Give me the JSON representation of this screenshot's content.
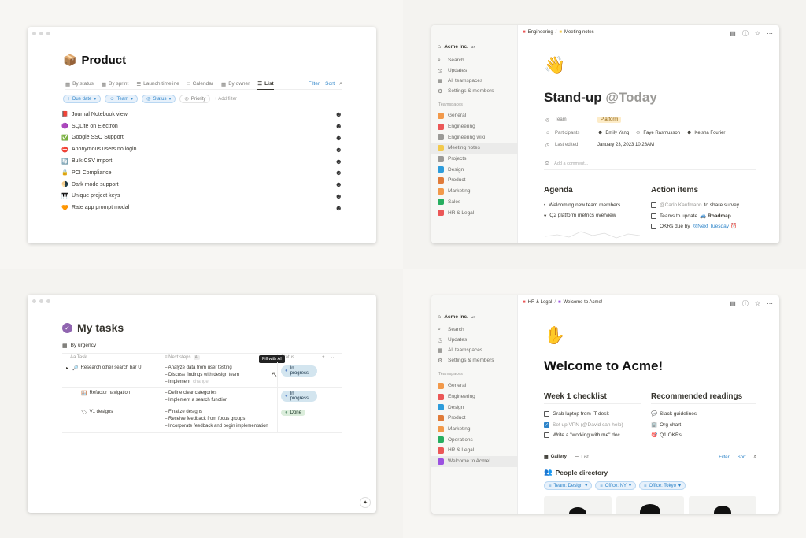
{
  "w1": {
    "title": "Product",
    "title_icon": "cube-icon",
    "tabs": [
      "By status",
      "By sprint",
      "Launch timeline",
      "Calendar",
      "By owner",
      "List"
    ],
    "filter": "Filter",
    "sort": "Sort",
    "filters": [
      "Due date",
      "Team",
      "Status",
      "Priority"
    ],
    "add_filter": "+ Add filter",
    "rows": [
      {
        "icon": "📕",
        "label": "Journal Notebook view"
      },
      {
        "icon": "🟣",
        "label": "SQLite on Electron"
      },
      {
        "icon": "✅",
        "label": "Google SSO Support"
      },
      {
        "icon": "⛔",
        "label": "Anonymous users no login"
      },
      {
        "icon": "🔄",
        "label": "Bulk CSV import"
      },
      {
        "icon": "🔒",
        "label": "PCI Compliance"
      },
      {
        "icon": "🌗",
        "label": "Dark mode support"
      },
      {
        "icon": "🎹",
        "label": "Unique project keys"
      },
      {
        "icon": "🧡",
        "label": "Rate app prompt modal"
      }
    ]
  },
  "w2": {
    "breadcrumb": [
      "Engineering",
      "Meeting notes"
    ],
    "workspace": "Acme Inc.",
    "nav": [
      "Search",
      "Updates",
      "All teamspaces",
      "Settings & members"
    ],
    "teamspaces_label": "Teamspaces",
    "teams": [
      {
        "label": "General",
        "color": "#f2994a"
      },
      {
        "label": "Engineering",
        "color": "#eb5757"
      },
      {
        "label": "Engineering wiki",
        "color": "#9b9a97"
      },
      {
        "label": "Meeting notes",
        "color": "#f2c94c"
      },
      {
        "label": "Projects",
        "color": "#9b9a97"
      },
      {
        "label": "Design",
        "color": "#2d9cdb"
      },
      {
        "label": "Product",
        "color": "#e07b39"
      },
      {
        "label": "Marketing",
        "color": "#f2994a"
      },
      {
        "label": "Sales",
        "color": "#27ae60"
      },
      {
        "label": "HR & Legal",
        "color": "#eb5757"
      }
    ],
    "title": "Stand-up",
    "title_mention": "@Today",
    "props": {
      "team_label": "Team",
      "team_value": "Platform",
      "participants_label": "Participants",
      "participants": [
        "Emily Yang",
        "Faye Rasmusson",
        "Keisha Fourier"
      ],
      "edited_label": "Last edited",
      "edited_value": "January 23, 2023 10:28AM"
    },
    "comment_placeholder": "Add a comment...",
    "agenda_title": "Agenda",
    "agenda": [
      "Welcoming new team members",
      "Q2 platform metrics overview"
    ],
    "actions_title": "Action items",
    "actions": [
      {
        "pre": "@Carlo Kaufmann",
        "text": "to share survey"
      },
      {
        "pre": "Teams to update",
        "link": "Roadmap"
      },
      {
        "pre": "OKRs due by",
        "link": "@Next Tuesday"
      }
    ]
  },
  "w3": {
    "title": "My tasks",
    "view": "By urgency",
    "cols": [
      "Task",
      "Next steps",
      "Status"
    ],
    "tooltip": "Fill with AI",
    "rows": [
      {
        "icon": "🔎",
        "task": "Research other search bar UI",
        "steps": [
          "– Analyze data from user testing",
          "– Discuss findings with design team",
          "– Implement"
        ],
        "steps_ghost": "change",
        "status": "In progress"
      },
      {
        "icon": "🪟",
        "task": "Refactor navigation",
        "steps": [
          "– Define clear categories",
          "– Implement a search function"
        ],
        "status": "In progress"
      },
      {
        "icon": "🏷",
        "task": "V1 designs",
        "steps": [
          "– Finalize designs",
          "– Receive feedback from focus groups",
          "– Incorporate feedback and begin implementation"
        ],
        "status": "Done"
      }
    ]
  },
  "w4": {
    "breadcrumb": [
      "HR & Legal",
      "Welcome to Acme!"
    ],
    "workspace": "Acme Inc.",
    "nav": [
      "Search",
      "Updates",
      "All teamspaces",
      "Settings & members"
    ],
    "teamspaces_label": "Teamspaces",
    "teams": [
      {
        "label": "General",
        "color": "#f2994a"
      },
      {
        "label": "Engineering",
        "color": "#eb5757"
      },
      {
        "label": "Design",
        "color": "#2d9cdb"
      },
      {
        "label": "Product",
        "color": "#e07b39"
      },
      {
        "label": "Marketing",
        "color": "#f2994a"
      },
      {
        "label": "Operations",
        "color": "#27ae60"
      },
      {
        "label": "HR & Legal",
        "color": "#eb5757"
      },
      {
        "label": "Welcome to Acme!",
        "color": "#9b51e0"
      }
    ],
    "title": "Welcome to Acme!",
    "checklist_title": "Week 1 checklist",
    "checklist": [
      {
        "text": "Grab laptop from IT desk",
        "done": false
      },
      {
        "text": "Set up VPN (@David can help)",
        "done": true
      },
      {
        "text": "Write a \"working with me\" doc",
        "done": false
      }
    ],
    "readings_title": "Recommended readings",
    "readings": [
      {
        "icon": "💬",
        "text": "Slack guidelines"
      },
      {
        "icon": "🏢",
        "text": "Org chart"
      },
      {
        "icon": "🎯",
        "text": "Q1 OKRs"
      }
    ],
    "tabs": [
      "Gallery",
      "List"
    ],
    "filter": "Filter",
    "sort": "Sort",
    "db_title": "People directory",
    "chips": [
      "Team: Design",
      "Office: NY",
      "Office: Tokyo"
    ]
  }
}
